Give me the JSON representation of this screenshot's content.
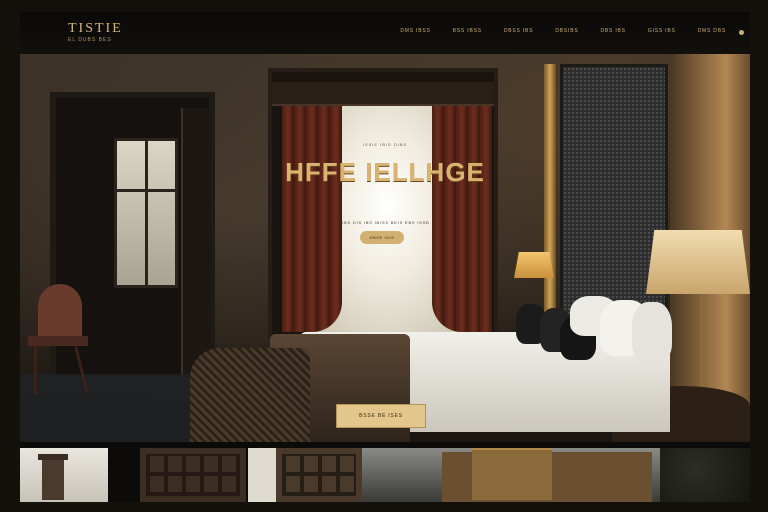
{
  "nav": {
    "logo_title": "TISTIE",
    "logo_subtitle": "EL DUBS BES",
    "links": [
      "DMS IBSS",
      "BSS IBSS",
      "DBSS IBS",
      "DBSIBS",
      "DBS IBS",
      "GISS IBS",
      "DMS DBS"
    ],
    "menu_icon": "dot-icon"
  },
  "hero": {
    "kicker": "ISSIE IBIS DIBS",
    "headline": "HFFE IELLHGE",
    "subline": "DBS DIS IBS IBISS BEIS EBS ISSB",
    "pill_button": "HBSE ISIS",
    "cta_button": "BSSE BE ISES"
  },
  "colors": {
    "accent_gold": "#d9b470",
    "nav_bg": "#0a0908",
    "cta_bg": "#e3c68b"
  }
}
